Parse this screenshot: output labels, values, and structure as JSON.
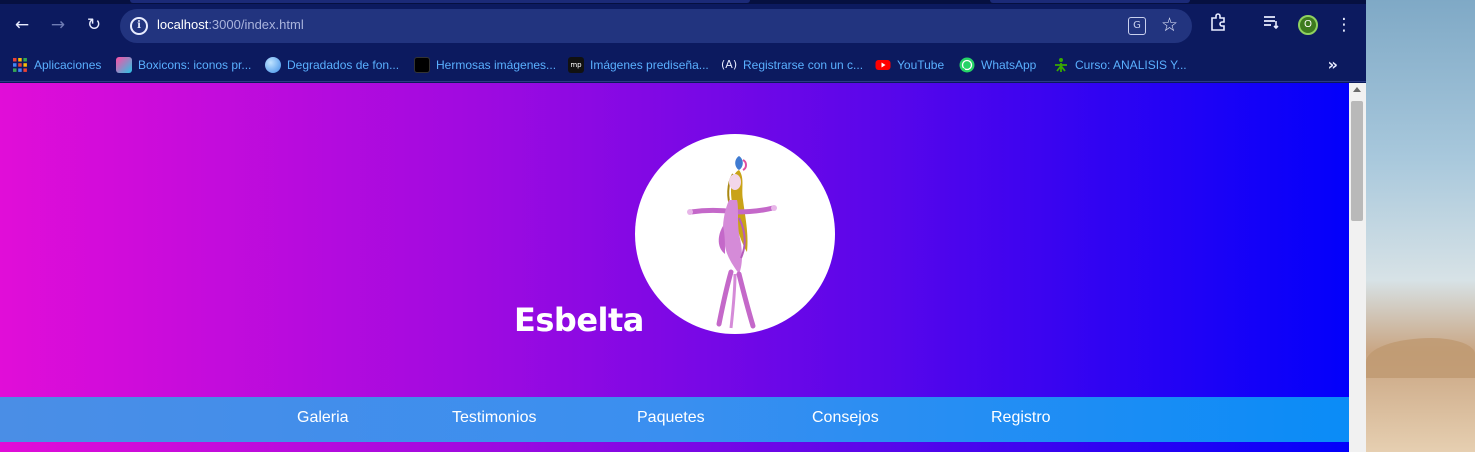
{
  "browser": {
    "url_host": "localhost",
    "url_path": ":3000/index.html",
    "profile_initial": "O",
    "bookmarks": [
      {
        "label": "Aplicaciones",
        "icon": "apps-grid-icon"
      },
      {
        "label": "Boxicons: iconos pr...",
        "icon": "boxicons-icon"
      },
      {
        "label": "Degradados de fon...",
        "icon": "gradient-icon"
      },
      {
        "label": "Hermosas imágenes...",
        "icon": "images-icon"
      },
      {
        "label": "Imágenes prediseña...",
        "icon": "clipart-icon"
      },
      {
        "label": "Registrarse con un c...",
        "icon": "signup-icon"
      },
      {
        "label": "YouTube",
        "icon": "youtube-icon"
      },
      {
        "label": "WhatsApp",
        "icon": "whatsapp-icon"
      },
      {
        "label": "Curso: ANALISIS Y...",
        "icon": "sena-icon"
      }
    ]
  },
  "page": {
    "brand": "Esbelta",
    "nav": [
      {
        "label": "Galeria"
      },
      {
        "label": "Testimonios"
      },
      {
        "label": "Paquetes"
      },
      {
        "label": "Consejos"
      },
      {
        "label": "Registro"
      }
    ]
  },
  "colors": {
    "gradient_start": "#e10dd8",
    "gradient_end": "#0200fb",
    "nav_bar": "#3a8ff0",
    "browser_chrome": "#0c1a5f"
  }
}
